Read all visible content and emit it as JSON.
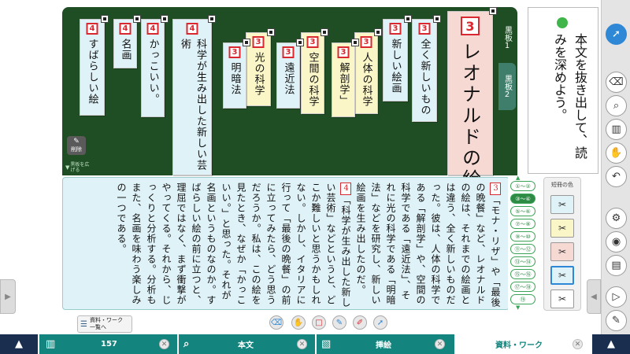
{
  "board": {
    "cards": [
      {
        "num": "3",
        "text": "レオナルドの絵",
        "color": "pink"
      },
      {
        "num": "3",
        "text": "全く新しいもの",
        "color": "blue"
      },
      {
        "num": "3",
        "text": "新しい絵画",
        "color": "blue"
      },
      {
        "num": "3",
        "text": "人体の科学",
        "color": "yellow"
      },
      {
        "num": "3",
        "text": "解剖学」",
        "color": "yellow"
      },
      {
        "num": "3",
        "text": "空間の科学",
        "color": "yellow"
      },
      {
        "num": "3",
        "text": "遠近法",
        "color": "blue"
      },
      {
        "num": "3",
        "text": "光の科学",
        "color": "yellow"
      },
      {
        "num": "3",
        "text": "明暗法",
        "color": "blue"
      },
      {
        "num": "4",
        "text": "科学が生み出した新しい芸術",
        "color": "blue"
      },
      {
        "num": "4",
        "text": "かっこいい。",
        "color": "blue"
      },
      {
        "num": "4",
        "text": "名画",
        "color": "blue"
      },
      {
        "num": "4",
        "text": "すばらしい絵",
        "color": "blue"
      }
    ],
    "tabs": [
      "黒板1",
      "黒板2"
    ],
    "delete_label": "削除",
    "expand_label": "黒板を広げる"
  },
  "question": {
    "text": "本文を抜き出して、読みを深めよう。"
  },
  "body_text": {
    "para3_num": "3",
    "para3": "「モナ・リザ」や「最後の晩餐」など、レオナルドの絵は、それまでの絵画とは違う、全く新しいものだった。彼は、人体の科学である「解剖学」や、空間の科学である「遠近法」、それに光の科学である「明暗法」などを研究し、新しい絵画を生み出したのだ。",
    "para4_num": "4",
    "para4": "「科学が生み出した新しい芸術」などというと、どこか難しいと思うかもしれない。しかし、イタリアに行って「最後の晩餐」の前に立ってみたら、どう思うだろうか。私は、この絵を見たとき、なぜか「かっこいい。」と思った。それが名画というものなのか。すばらしい絵の前に立つと、理屈ではなく、まず衝撃がやってくる。それから、じっくりと分析する。分析もまた、名画を味わう楽しみの一つである。"
  },
  "section_nav": {
    "items": [
      "①〜②",
      "③〜④",
      "⑤〜⑥",
      "⑦〜⑧",
      "⑨〜⑩",
      "⑪〜⑫",
      "⑬〜⑭",
      "⑮〜⑯",
      "⑰〜⑱",
      "⑲"
    ],
    "active_index": 1
  },
  "color_panel": {
    "title": "短冊の色",
    "swatches": [
      "#dff2f8",
      "#fbf6c8",
      "#f6d9d3",
      "#dff2f8",
      "#ffffff"
    ]
  },
  "resource_button": {
    "line1": "資料・ワーク",
    "line2": "一覧へ"
  },
  "tabbar": {
    "tabs": [
      {
        "label": "157",
        "icon": "book-icon"
      },
      {
        "label": "本文",
        "icon": "page-zoom-icon"
      },
      {
        "label": "挿絵",
        "icon": "image-zoom-icon"
      },
      {
        "label": "資料・ワーク",
        "icon": ""
      }
    ]
  },
  "colors": {
    "board": "#1f4e24",
    "accent": "#13857e",
    "number_red": "#d9282f"
  }
}
